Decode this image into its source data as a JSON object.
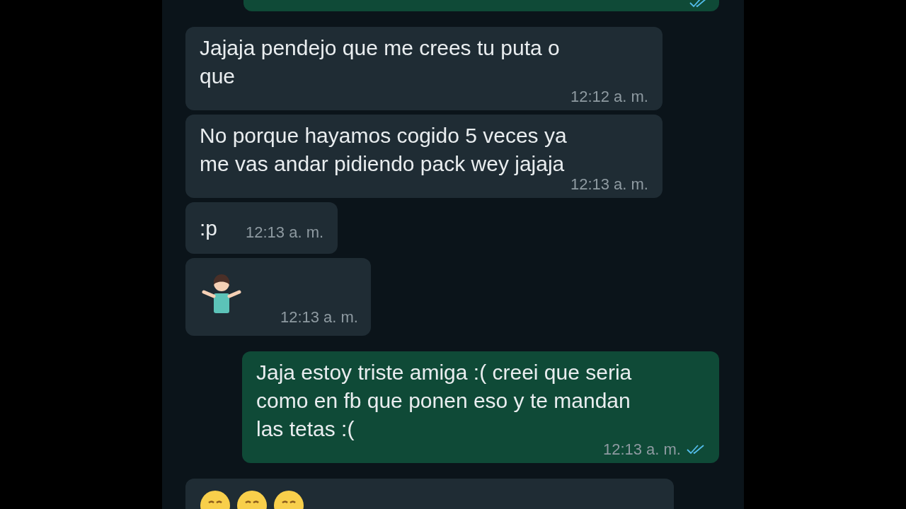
{
  "messages": [
    {
      "outgoing": true,
      "kind": "cut-top",
      "read": true
    },
    {
      "outgoing": false,
      "kind": "text",
      "text": "Jajaja pendejo que me crees tu puta o que",
      "time": "12:12 a. m."
    },
    {
      "outgoing": false,
      "kind": "text",
      "text": "No porque hayamos cogido 5 veces ya me vas andar pidiendo pack wey jajaja",
      "time": "12:13 a. m."
    },
    {
      "outgoing": false,
      "kind": "short",
      "text": ":p",
      "time": "12:13 a. m."
    },
    {
      "outgoing": false,
      "kind": "emoji",
      "time": "12:13 a. m."
    },
    {
      "outgoing": true,
      "kind": "text",
      "text": "Jaja estoy triste amiga :( creei que seria como en fb que ponen eso y te mandan las tetas :(",
      "time": "12:13 a. m.",
      "read": true
    },
    {
      "outgoing": false,
      "kind": "cut-bottom"
    }
  ]
}
